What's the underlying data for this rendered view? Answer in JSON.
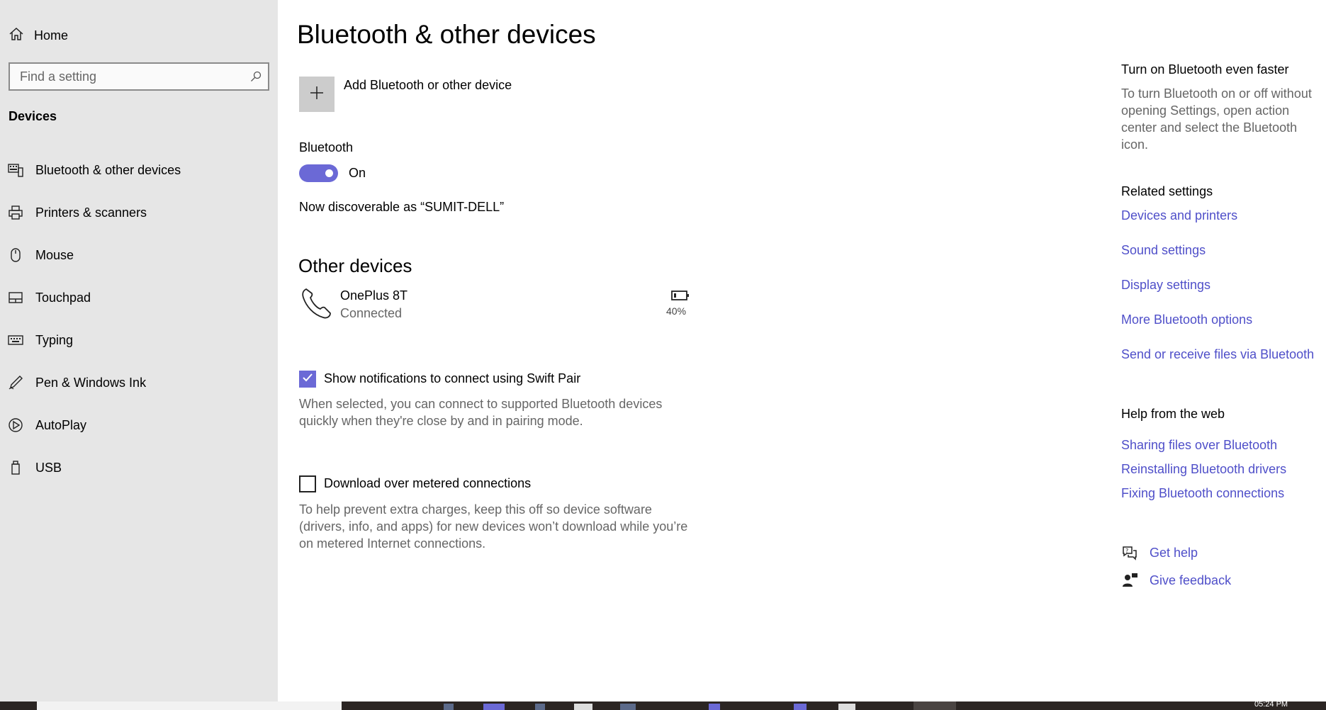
{
  "sidebar": {
    "home_label": "Home",
    "search_placeholder": "Find a setting",
    "section_title": "Devices",
    "items": [
      {
        "label": "Bluetooth & other devices",
        "icon": "bluetooth-devices-icon"
      },
      {
        "label": "Printers & scanners",
        "icon": "printer-icon"
      },
      {
        "label": "Mouse",
        "icon": "mouse-icon"
      },
      {
        "label": "Touchpad",
        "icon": "touchpad-icon"
      },
      {
        "label": "Typing",
        "icon": "keyboard-icon"
      },
      {
        "label": "Pen & Windows Ink",
        "icon": "pen-icon"
      },
      {
        "label": "AutoPlay",
        "icon": "autoplay-icon"
      },
      {
        "label": "USB",
        "icon": "usb-icon"
      }
    ]
  },
  "main": {
    "title": "Bluetooth & other devices",
    "add_device_label": "Add Bluetooth or other device",
    "bluetooth_label": "Bluetooth",
    "bluetooth_state": "On",
    "bluetooth_on": true,
    "discoverable_text": "Now discoverable as “SUMIT-DELL”",
    "other_devices_title": "Other devices",
    "device": {
      "name": "OnePlus 8T",
      "status": "Connected",
      "battery": "40%"
    },
    "swift_pair": {
      "label": "Show notifications to connect using Swift Pair",
      "checked": true,
      "description": "When selected, you can connect to supported Bluetooth devices quickly when they're close by and in pairing mode."
    },
    "metered": {
      "label": "Download over metered connections",
      "checked": false,
      "description": "To help prevent extra charges, keep this off so device software (drivers, info, and apps) for new devices won’t download while you’re on metered Internet connections."
    }
  },
  "right": {
    "faster_heading": "Turn on Bluetooth even faster",
    "faster_text": "To turn Bluetooth on or off without opening Settings, open action center and select the Bluetooth icon.",
    "related_heading": "Related settings",
    "related_links": [
      "Devices and printers",
      "Sound settings",
      "Display settings",
      "More Bluetooth options",
      "Send or receive files via Bluetooth"
    ],
    "help_heading": "Help from the web",
    "help_links": [
      "Sharing files over Bluetooth",
      "Reinstalling Bluetooth drivers",
      "Fixing Bluetooth connections"
    ],
    "get_help": "Get help",
    "give_feedback": "Give feedback"
  },
  "taskbar": {
    "clock": "05:24 PM"
  },
  "colors": {
    "accent": "#6b69d6",
    "link": "#4f4fc9",
    "sidebar_bg": "#e6e6e6",
    "taskbar_bg": "#2b2523"
  }
}
